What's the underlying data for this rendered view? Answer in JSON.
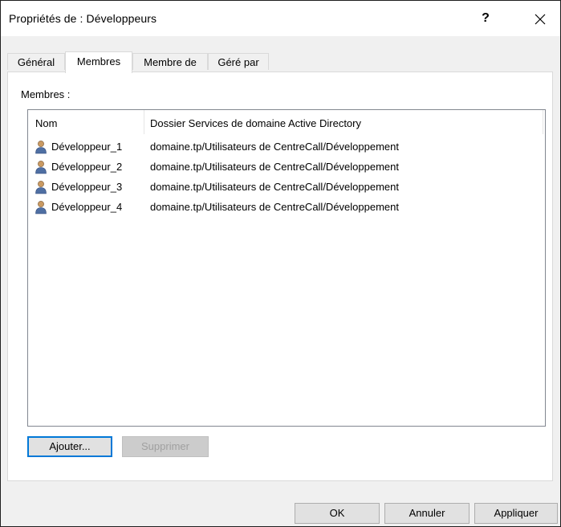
{
  "window": {
    "title": "Propriétés de : Développeurs",
    "help_label": "?"
  },
  "tabs": [
    {
      "label": "Général"
    },
    {
      "label": "Membres"
    },
    {
      "label": "Membre de"
    },
    {
      "label": "Géré par"
    }
  ],
  "members": {
    "label": "Membres :",
    "columns": [
      "Nom",
      "Dossier Services de domaine Active Directory"
    ],
    "rows": [
      {
        "name": "Développeur_1",
        "folder": "domaine.tp/Utilisateurs de CentreCall/Développement"
      },
      {
        "name": "Développeur_2",
        "folder": "domaine.tp/Utilisateurs de CentreCall/Développement"
      },
      {
        "name": "Développeur_3",
        "folder": "domaine.tp/Utilisateurs de CentreCall/Développement"
      },
      {
        "name": "Développeur_4",
        "folder": "domaine.tp/Utilisateurs de CentreCall/Développement"
      }
    ],
    "add_label": "Ajouter...",
    "remove_label": "Supprimer"
  },
  "footer": {
    "ok_label": "OK",
    "cancel_label": "Annuler",
    "apply_label": "Appliquer"
  },
  "icons": {
    "user": "user-icon",
    "close": "close-icon"
  }
}
